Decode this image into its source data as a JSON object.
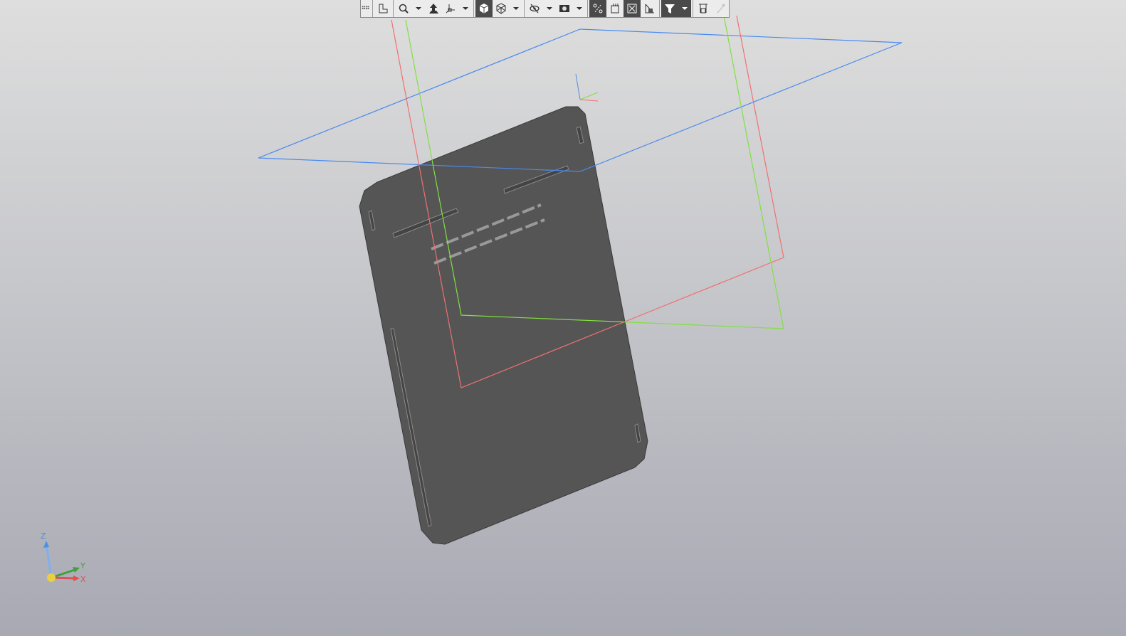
{
  "toolbar": {
    "buttons": [
      {
        "icon": "grip-icon"
      },
      {
        "icon": "local-coordinate-system-icon"
      },
      {
        "icon": "zoom-region-icon"
      },
      {
        "icon": "orientation-icon"
      },
      {
        "icon": "triad-icon"
      },
      {
        "icon": "shaded-view-icon",
        "active": true
      },
      {
        "icon": "wireframe-view-icon"
      },
      {
        "icon": "hide-icon"
      },
      {
        "icon": "camera-icon"
      },
      {
        "icon": "constraints-icon",
        "active": true
      },
      {
        "icon": "sketch-icon"
      },
      {
        "icon": "section-icon",
        "active": true
      },
      {
        "icon": "measure-icon"
      },
      {
        "icon": "filter-icon",
        "active": true
      },
      {
        "icon": "properties-icon"
      },
      {
        "icon": "eyedropper-icon",
        "disabled": true
      }
    ]
  },
  "triad": {
    "x": "X",
    "y": "Y",
    "z": "Z"
  },
  "colors": {
    "x_axis": "#e05050",
    "y_axis": "#40b040",
    "z_axis": "#5090e0",
    "plate": "#555555",
    "xy_plane": "#4a8af0",
    "xz_plane": "#f07070",
    "yz_plane": "#80e040"
  }
}
